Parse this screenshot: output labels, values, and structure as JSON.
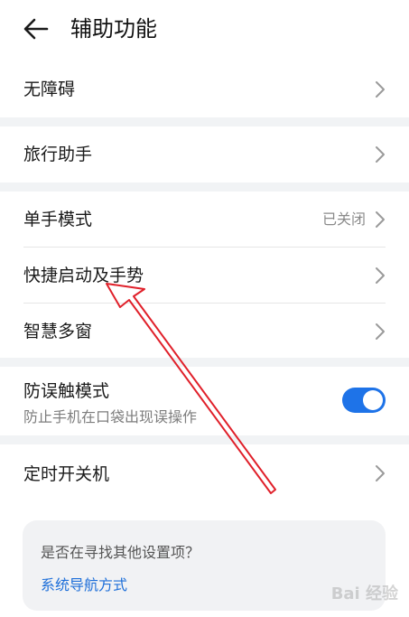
{
  "header": {
    "title": "辅助功能"
  },
  "rows": {
    "accessibility": {
      "label": "无障碍"
    },
    "travel": {
      "label": "旅行助手"
    },
    "one_hand": {
      "label": "单手模式",
      "value": "已关闭"
    },
    "shortcut": {
      "label": "快捷启动及手势"
    },
    "smart_window": {
      "label": "智慧多窗"
    },
    "mistouch": {
      "label": "防误触模式",
      "sub": "防止手机在口袋出现误操作",
      "toggle_on": true
    },
    "schedule_power": {
      "label": "定时开关机"
    }
  },
  "suggest": {
    "question": "是否在寻找其他设置项？",
    "link": "系统导航方式"
  },
  "colors": {
    "accent": "#1e73e8",
    "annotation": "#e0202a"
  },
  "watermark": "Bai 经验"
}
